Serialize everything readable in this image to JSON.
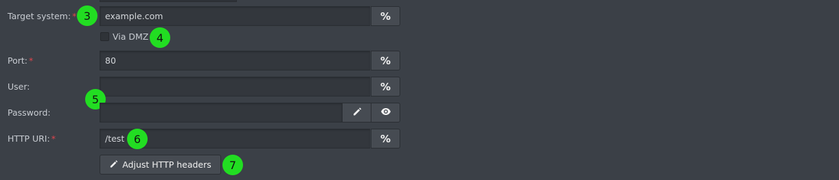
{
  "form": {
    "target_system": {
      "label": "Target system:",
      "required_mark": "*",
      "value": "example.com",
      "macro_button": "%"
    },
    "via_dmz": {
      "label": "Via DMZ",
      "checked": false
    },
    "port": {
      "label": "Port:",
      "required_mark": "*",
      "value": "80",
      "macro_button": "%"
    },
    "user": {
      "label": "User:",
      "value": "",
      "macro_button": "%"
    },
    "password": {
      "label": "Password:",
      "value": "",
      "edit_icon": "pencil-icon",
      "show_icon": "eye-icon"
    },
    "http_uri": {
      "label": "HTTP URI:",
      "required_mark": "*",
      "value": "/test",
      "macro_button": "%"
    },
    "adjust_headers_button": {
      "label": "Adjust HTTP headers",
      "icon": "pencil-icon"
    }
  },
  "markers": [
    "3",
    "4",
    "5",
    "6",
    "7"
  ],
  "colors": {
    "background": "#3b4047",
    "input_bg": "#33373d",
    "button_bg": "#464b52",
    "required": "#e0454d",
    "marker": "#22dd22"
  }
}
